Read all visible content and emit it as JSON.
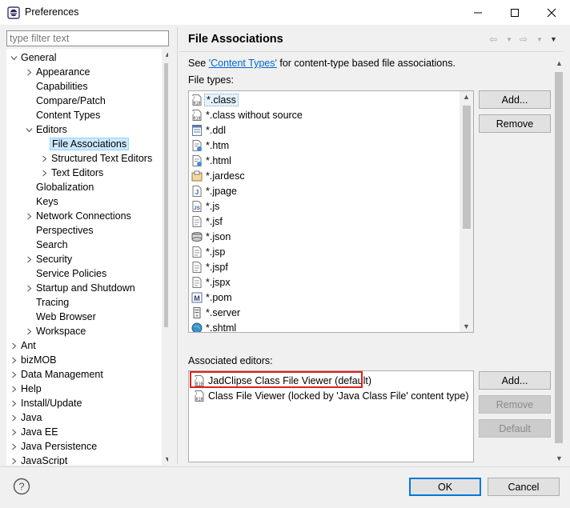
{
  "window": {
    "title": "Preferences",
    "app_icon": "eclipse-icon",
    "controls": [
      "minimize-icon",
      "maximize-icon",
      "close-icon"
    ]
  },
  "filter": {
    "placeholder": "type filter text",
    "value": ""
  },
  "tree": [
    {
      "label": "General",
      "expanded": true,
      "expandable": true,
      "level": 0
    },
    {
      "label": "Appearance",
      "expandable": true,
      "level": 1
    },
    {
      "label": "Capabilities",
      "level": 1
    },
    {
      "label": "Compare/Patch",
      "level": 1
    },
    {
      "label": "Content Types",
      "level": 1
    },
    {
      "label": "Editors",
      "expanded": true,
      "expandable": true,
      "level": 1
    },
    {
      "label": "File Associations",
      "selected": true,
      "level": 2
    },
    {
      "label": "Structured Text Editors",
      "expandable": true,
      "level": 2
    },
    {
      "label": "Text Editors",
      "expandable": true,
      "level": 2
    },
    {
      "label": "Globalization",
      "level": 1
    },
    {
      "label": "Keys",
      "level": 1
    },
    {
      "label": "Network Connections",
      "expandable": true,
      "level": 1
    },
    {
      "label": "Perspectives",
      "level": 1
    },
    {
      "label": "Search",
      "level": 1
    },
    {
      "label": "Security",
      "expandable": true,
      "level": 1
    },
    {
      "label": "Service Policies",
      "level": 1
    },
    {
      "label": "Startup and Shutdown",
      "expandable": true,
      "level": 1
    },
    {
      "label": "Tracing",
      "level": 1
    },
    {
      "label": "Web Browser",
      "level": 1
    },
    {
      "label": "Workspace",
      "expandable": true,
      "level": 1
    },
    {
      "label": "Ant",
      "expandable": true,
      "level": 0
    },
    {
      "label": "bizMOB",
      "expandable": true,
      "level": 0
    },
    {
      "label": "Data Management",
      "expandable": true,
      "level": 0
    },
    {
      "label": "Help",
      "expandable": true,
      "level": 0
    },
    {
      "label": "Install/Update",
      "expandable": true,
      "level": 0
    },
    {
      "label": "Java",
      "expandable": true,
      "level": 0
    },
    {
      "label": "Java EE",
      "expandable": true,
      "level": 0
    },
    {
      "label": "Java Persistence",
      "expandable": true,
      "level": 0
    },
    {
      "label": "JavaScript",
      "expandable": true,
      "level": 0
    }
  ],
  "page": {
    "title": "File Associations",
    "see_prefix": "See ",
    "see_link": "'Content Types'",
    "see_suffix": " for content-type based file associations.",
    "file_types_label": "File types:",
    "associated_editors_label": "Associated editors:"
  },
  "file_types": [
    {
      "name": "*.class",
      "icon": "class-file-icon",
      "selected": true
    },
    {
      "name": "*.class without source",
      "icon": "class-file-icon"
    },
    {
      "name": "*.ddl",
      "icon": "ddl-file-icon"
    },
    {
      "name": "*.htm",
      "icon": "html-file-icon"
    },
    {
      "name": "*.html",
      "icon": "html-file-icon"
    },
    {
      "name": "*.jardesc",
      "icon": "jardesc-file-icon"
    },
    {
      "name": "*.jpage",
      "icon": "jpage-file-icon"
    },
    {
      "name": "*.js",
      "icon": "js-file-icon"
    },
    {
      "name": "*.jsf",
      "icon": "jsf-file-icon"
    },
    {
      "name": "*.json",
      "icon": "json-file-icon"
    },
    {
      "name": "*.jsp",
      "icon": "jsp-file-icon"
    },
    {
      "name": "*.jspf",
      "icon": "jsp-file-icon"
    },
    {
      "name": "*.jspx",
      "icon": "jsp-file-icon"
    },
    {
      "name": "*.pom",
      "icon": "maven-pom-icon"
    },
    {
      "name": "*.server",
      "icon": "server-file-icon"
    },
    {
      "name": "*.shtml",
      "icon": "globe-file-icon"
    }
  ],
  "editors": [
    {
      "name": "JadClipse Class File Viewer (default)",
      "icon": "class-file-icon",
      "highlighted": true
    },
    {
      "name": "Class File Viewer (locked by 'Java Class File' content type)",
      "icon": "class-file-icon"
    }
  ],
  "buttons": {
    "add_types": "Add...",
    "remove_types": "Remove",
    "add_editors": "Add...",
    "remove_editors": "Remove",
    "default_editor": "Default",
    "ok": "OK",
    "cancel": "Cancel"
  },
  "colors": {
    "selection": "#cce8ff",
    "link": "#0066cc",
    "highlight_border": "#e0211b",
    "default_button_border": "#0078d7"
  }
}
